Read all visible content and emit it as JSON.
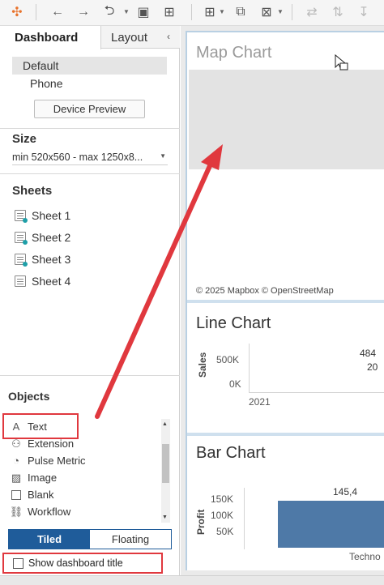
{
  "left_panel": {
    "tabs": {
      "dashboard": "Dashboard",
      "layout": "Layout"
    },
    "devices": [
      "Default",
      "Phone"
    ],
    "device_preview_label": "Device Preview",
    "size": {
      "title": "Size",
      "value": "min 520x560 - max 1250x8..."
    },
    "sheets": {
      "title": "Sheets",
      "items": [
        "Sheet 1",
        "Sheet 2",
        "Sheet 3",
        "Sheet 4"
      ]
    },
    "objects": {
      "title": "Objects",
      "items": [
        "Text",
        "Extension",
        "Pulse Metric",
        "Image",
        "Blank",
        "Workflow"
      ]
    },
    "toggle": {
      "tiled": "Tiled",
      "floating": "Floating"
    },
    "show_title_label": "Show dashboard title"
  },
  "canvas": {
    "map": {
      "title": "Map Chart",
      "credit": "© 2025 Mapbox © OpenStreetMap"
    },
    "line": {
      "title": "Line Chart",
      "ylabel": "Sales",
      "y_ticks": [
        "500K",
        "0K"
      ],
      "x_tick": "2021",
      "value_labels": [
        "484",
        "20"
      ]
    },
    "bar": {
      "title": "Bar Chart",
      "ylabel": "Profit",
      "y_ticks": [
        "150K",
        "100K",
        "50K"
      ],
      "value_label": "145,4",
      "category": "Techno"
    }
  },
  "colors": {
    "accent": "#1f5c9a",
    "highlight": "#e0383e",
    "bar": "#4e79a7"
  }
}
